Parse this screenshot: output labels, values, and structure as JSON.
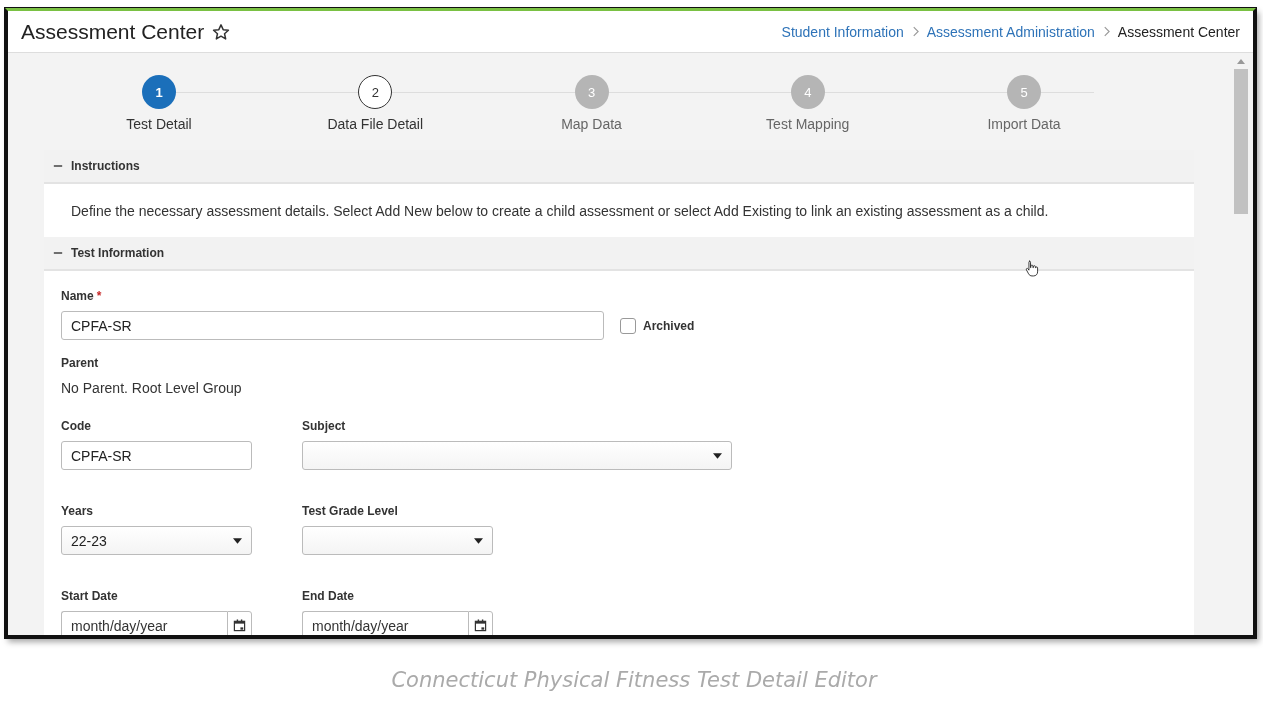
{
  "header": {
    "title": "Assessment Center",
    "favorite": false,
    "breadcrumbs": [
      {
        "label": "Student Information",
        "kind": "link"
      },
      {
        "label": "Assessment Administration",
        "kind": "link"
      },
      {
        "label": "Assessment Center",
        "kind": "current"
      }
    ]
  },
  "steps": [
    {
      "number": "1",
      "label": "Test Detail",
      "kind": "current"
    },
    {
      "number": "2",
      "label": "Data File Detail",
      "kind": "available"
    },
    {
      "number": "3",
      "label": "Map Data",
      "kind": "disabled"
    },
    {
      "number": "4",
      "label": "Test Mapping",
      "kind": "disabled"
    },
    {
      "number": "5",
      "label": "Import Data",
      "kind": "disabled"
    }
  ],
  "sections": [
    {
      "title": "Instructions",
      "expanded": true,
      "text": "Define the necessary assessment details. Select Add New below to create a child assessment or select Add Existing to link an existing assessment as a child."
    },
    {
      "title": "Test Information",
      "expanded": true
    }
  ],
  "form": {
    "name": {
      "label": "Name",
      "required_mark": "*",
      "value": "CPFA-SR"
    },
    "archived": {
      "label": "Archived",
      "checked": false
    },
    "parent": {
      "label": "Parent",
      "value": "No Parent. Root Level Group"
    },
    "code": {
      "label": "Code",
      "value": "CPFA-SR"
    },
    "subject": {
      "label": "Subject"
    },
    "years": {
      "label": "Years",
      "value": "22-23"
    },
    "grade": {
      "label": "Test Grade Level"
    },
    "start_date": {
      "label": "Start Date",
      "placeholder": "month/day/year"
    },
    "end_date": {
      "label": "End Date",
      "placeholder": "month/day/year"
    }
  },
  "caption": "Connecticut Physical Fitness Test Detail Editor"
}
